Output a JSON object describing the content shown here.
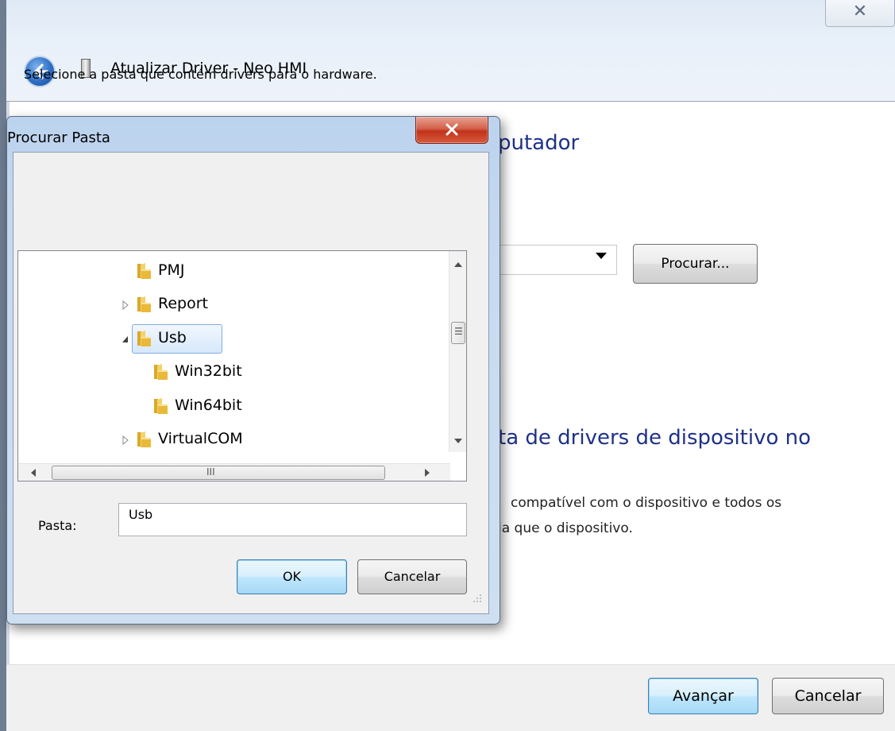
{
  "wizard": {
    "title": "Atualizar Driver -  Neo HMI",
    "heading": "putador",
    "option_title": "ta de drivers de dispositivo no",
    "option_desc_line1": "compatível com o dispositivo e todos os",
    "option_desc_line2": "ia que o dispositivo.",
    "browse_label": "Procurar...",
    "next_label": "Avançar",
    "cancel_label": "Cancelar",
    "close_glyph": "✕"
  },
  "dialog": {
    "title": "Procurar Pasta",
    "instruction": "Selecione a pasta que contém drivers para o hardware.",
    "folder_label": "Pasta:",
    "folder_value": "Usb",
    "ok_label": "OK",
    "cancel_label": "Cancelar",
    "tree": [
      {
        "label": "PMJ",
        "expander": "none",
        "selected": false
      },
      {
        "label": "Report",
        "expander": "collapsed",
        "selected": false
      },
      {
        "label": "Usb",
        "expander": "expanded",
        "selected": true
      },
      {
        "label": "Win32bit",
        "expander": "none",
        "selected": false
      },
      {
        "label": "Win64bit",
        "expander": "none",
        "selected": false
      },
      {
        "label": "VirtualCOM",
        "expander": "collapsed",
        "selected": false
      }
    ],
    "hscroll_grip": "III",
    "vscroll_grip": "☰"
  },
  "colors": {
    "heading_blue": "#1e3287",
    "folder_yellow": "#f2c94c",
    "close_red": "#c2331a"
  }
}
